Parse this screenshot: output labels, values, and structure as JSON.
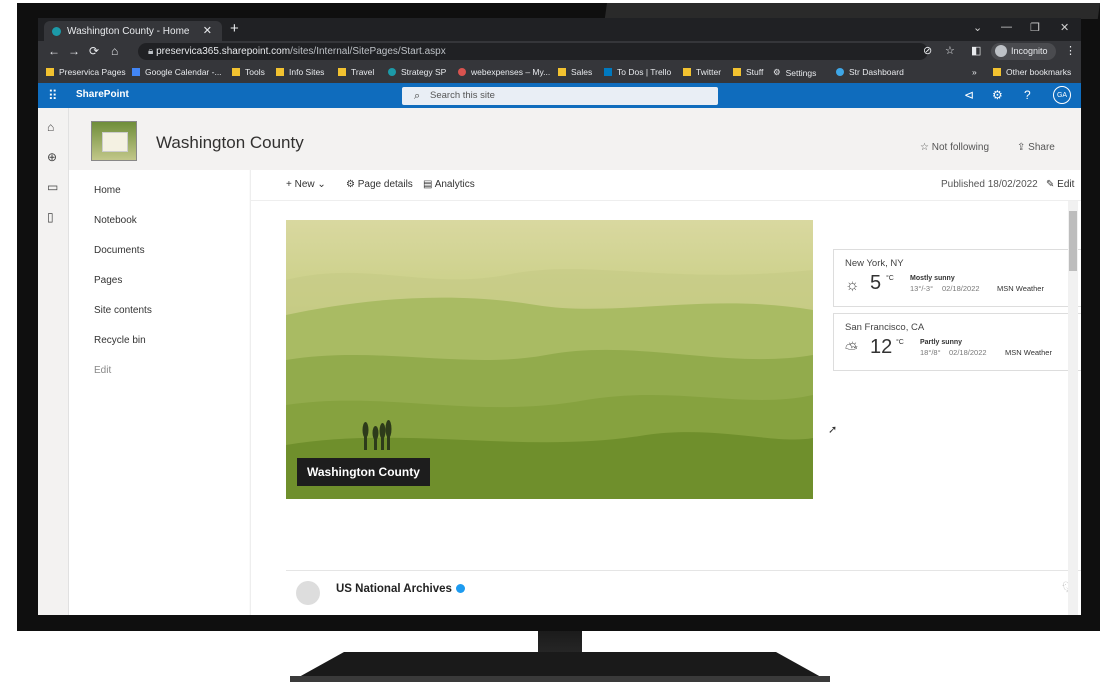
{
  "browser": {
    "tab_title": "Washington County - Home",
    "url_host": "preservica365.sharepoint.com",
    "url_path": "/sites/Internal/SitePages/Start.aspx",
    "profile": "Incognito",
    "bookmarks": [
      "Preservica Pages",
      "Google Calendar -...",
      "Tools",
      "Info Sites",
      "Travel",
      "Strategy SP",
      "webexpenses – My...",
      "Sales",
      "To Dos | Trello",
      "Twitter",
      "Stuff",
      "Settings",
      "Str Dashboard"
    ],
    "other_bookmarks": "Other bookmarks"
  },
  "sharepoint": {
    "app_name": "SharePoint",
    "search_placeholder": "Search this site",
    "avatar_initials": "GA",
    "site_title": "Washington County",
    "follow_label": "Not following",
    "share_label": "Share"
  },
  "leftnav": [
    "Home",
    "Notebook",
    "Documents",
    "Pages",
    "Site contents",
    "Recycle bin",
    "Edit"
  ],
  "commandbar": {
    "new": "New",
    "page_details": "Page details",
    "analytics": "Analytics",
    "published": "Published 18/02/2022",
    "edit": "Edit"
  },
  "hero": {
    "title": "Washington County"
  },
  "weather": [
    {
      "city": "New York, NY",
      "temp": "5",
      "unit": "°C",
      "condition": "Mostly sunny",
      "range": "13°/-3°",
      "date": "02/18/2022",
      "source": "MSN Weather"
    },
    {
      "city": "San Francisco, CA",
      "temp": "12",
      "unit": "°C",
      "condition": "Partly sunny",
      "range": "18°/8°",
      "date": "02/18/2022",
      "source": "MSN Weather"
    }
  ],
  "feed": {
    "account": "US National Archives"
  },
  "colors": {
    "sharepoint_blue": "#0f6cbd",
    "chrome_dark": "#35363a"
  }
}
